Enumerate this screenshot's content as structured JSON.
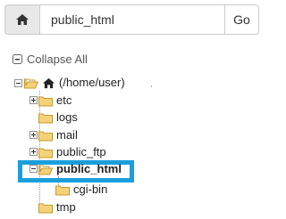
{
  "path_bar": {
    "home_icon": "home-icon",
    "value": "public_html",
    "go_label": "Go"
  },
  "collapse_all": {
    "icon": "collapse-icon",
    "label": "Collapse All"
  },
  "tree": {
    "root": {
      "label": "(/home/user)",
      "icon": "home-icon"
    },
    "items": [
      {
        "label": "etc",
        "expandable": true
      },
      {
        "label": "logs",
        "expandable": false
      },
      {
        "label": "mail",
        "expandable": true
      },
      {
        "label": "public_ftp",
        "expandable": true
      },
      {
        "label": "public_html",
        "expandable": true,
        "expanded": true,
        "selected": true
      },
      {
        "label": "cgi-bin",
        "expandable": false,
        "child_of": "public_html"
      },
      {
        "label": "tmp",
        "expandable": false
      }
    ]
  },
  "colors": {
    "selection_border": "#1a9fdb",
    "folder_fill": "#f3d27a",
    "folder_stroke": "#c89a2f"
  }
}
